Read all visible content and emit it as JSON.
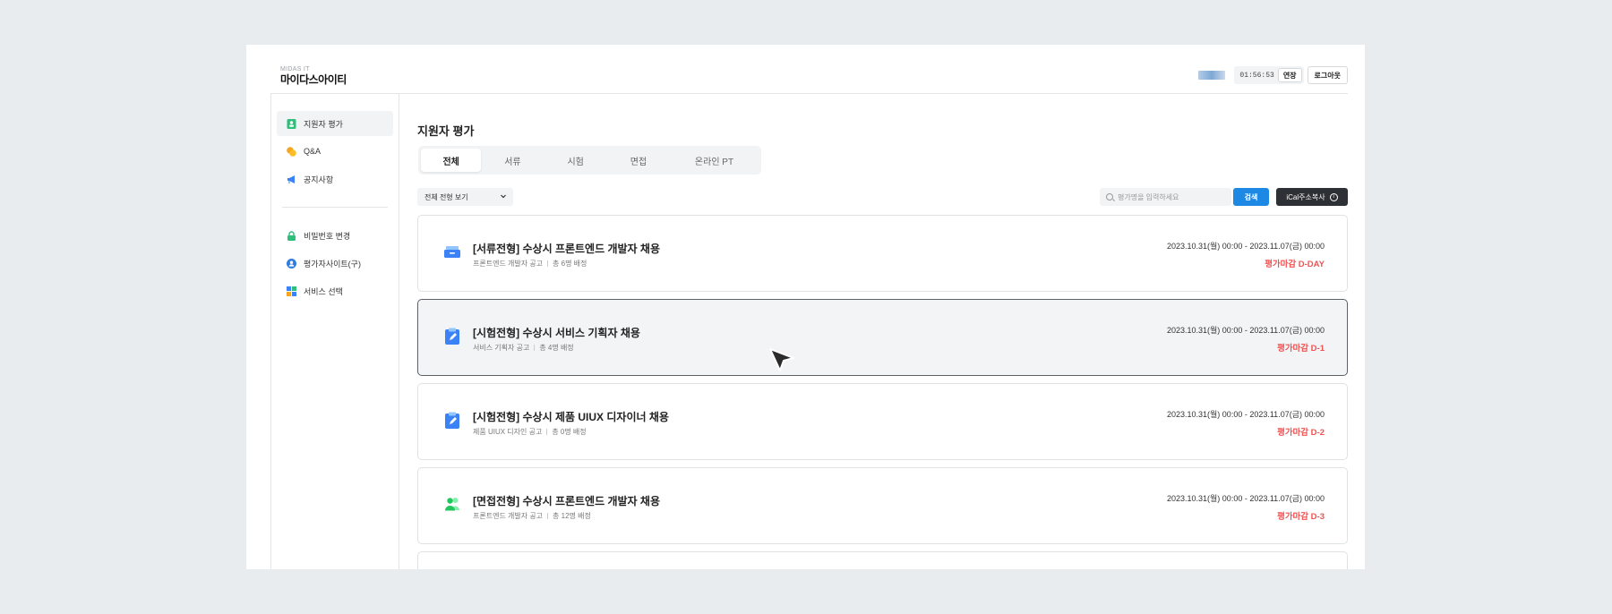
{
  "header": {
    "logo_sub": "MIDAS IT",
    "logo_main": "마이다스아이티",
    "timer": "01:56:53",
    "extend_label": "연장",
    "logout_label": "로그아웃"
  },
  "sidebar": {
    "items": [
      {
        "label": "지원자 평가",
        "icon": "applicant-icon",
        "color": "#2ebf7a",
        "active": true
      },
      {
        "label": "Q&A",
        "icon": "chat-icon",
        "color": "#f5a524"
      },
      {
        "label": "공지사항",
        "icon": "megaphone-icon",
        "color": "#3b82f6"
      },
      {
        "label": "비밀번호 변경",
        "icon": "lock-icon",
        "color": "#2ebf7a"
      },
      {
        "label": "평가자사이트(구)",
        "icon": "user-circle-icon",
        "color": "#2f7de1"
      },
      {
        "label": "서비스 선택",
        "icon": "grid-icon",
        "color": "#3b82f6"
      }
    ]
  },
  "main": {
    "title": "지원자 평가",
    "tabs": [
      "전체",
      "서류",
      "시험",
      "면접",
      "온라인 PT"
    ],
    "filter_label": "전체 전형 보기",
    "search_placeholder": "평가명을 입력하세요",
    "search_button": "검색",
    "ical_button": "iCal주소복사",
    "cards": [
      {
        "title": "[서류전형] 수상시 프론트엔드 개발자 채용",
        "notice": "프론트엔드 개발자 공고",
        "count": "총 6명 배정",
        "period": "2023.10.31(월) 00:00 - 2023.11.07(금) 00:00",
        "deadline": "평가마감 D-DAY",
        "icon": "document-tray-icon"
      },
      {
        "title": "[시험전형] 수상시 서비스 기획자 채용",
        "notice": "서비스 기획자 공고",
        "count": "총 4명 배정",
        "period": "2023.10.31(월) 00:00 - 2023.11.07(금) 00:00",
        "deadline": "평가마감 D-1",
        "icon": "clipboard-pen-icon"
      },
      {
        "title": "[시험전형] 수상시 제품 UIUX 디자이너 채용",
        "notice": "제품 UIUX 디자인 공고",
        "count": "총 0명 배정",
        "period": "2023.10.31(월) 00:00 - 2023.11.07(금) 00:00",
        "deadline": "평가마감 D-2",
        "icon": "clipboard-pen-icon"
      },
      {
        "title": "[면접전형] 수상시 프론트엔드 개발자 채용",
        "notice": "프론트엔드 개발자 공고",
        "count": "총 12명 배정",
        "period": "2023.10.31(월) 00:00 - 2023.11.07(금) 00:00",
        "deadline": "평가마감 D-3",
        "icon": "people-icon"
      }
    ]
  },
  "colors": {
    "accent": "#1e88e5",
    "deadline": "#f05252",
    "dark_button": "#2d3034"
  }
}
